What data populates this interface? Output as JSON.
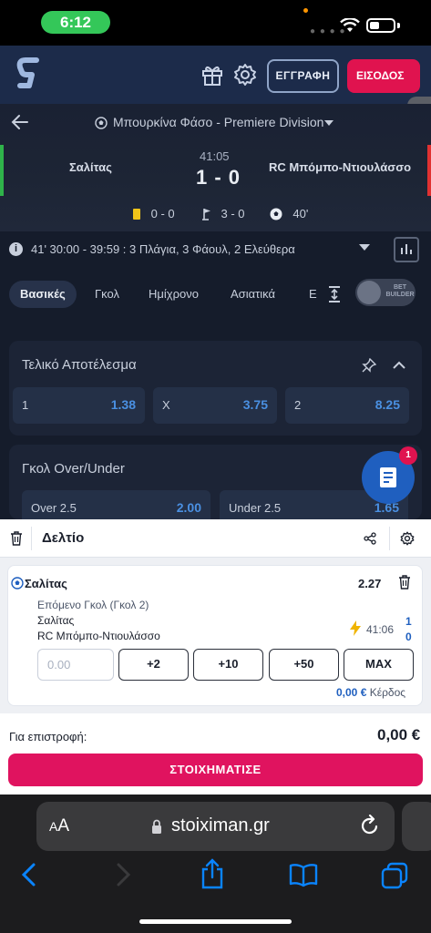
{
  "status": {
    "time": "6:12"
  },
  "header": {
    "register_label": "ΕΓΓΡΑΦΗ",
    "login_label": "ΕΙΣΟΔΟΣ"
  },
  "match": {
    "league": "Μπουρκίνα Φάσο - Premiere Division",
    "home_team": "Σαλίτας",
    "away_team": "RC Μπόμπο-Ντιουλάσσο",
    "minute": "41:05",
    "score": "1 - 0",
    "stats": {
      "cards": "0 - 0",
      "corners": "3 - 0",
      "time": "40'"
    }
  },
  "info": {
    "text": "41'  30:00 - 39:59 : 3 Πλάγια, 3 Φάουλ, 2 Ελεύθερα"
  },
  "tabs": [
    "Βασικές",
    "Γκολ",
    "Ημίχρονο",
    "Ασιατικά",
    "Ε"
  ],
  "bet_builder": "BET BUILDER",
  "markets": {
    "result": {
      "title": "Τελικό Αποτέλεσμα",
      "odds": [
        {
          "label": "1",
          "value": "1.38"
        },
        {
          "label": "X",
          "value": "3.75"
        },
        {
          "label": "2",
          "value": "8.25"
        }
      ]
    },
    "overunder": {
      "title": "Γκολ Over/Under",
      "odds": [
        {
          "label": "Over 2.5",
          "value": "2.00"
        },
        {
          "label": "Under 2.5",
          "value": "1.65"
        }
      ]
    }
  },
  "fab_badge": "1",
  "slip": {
    "title": "Δελτίο",
    "selection": {
      "team": "Σαλίτας",
      "odd": "2.27",
      "market": "Επόμενο Γκολ (Γκολ 2)",
      "team1": "Σαλίτας",
      "team2": "RC Μπόμπο-Ντιουλάσσο",
      "time": "41:06",
      "score1": "1",
      "score2": "0"
    },
    "stake_placeholder": "0.00",
    "quick": [
      "+2",
      "+10",
      "+50",
      "MAX"
    ],
    "winnings_value": "0,00 €",
    "winnings_label": "Κέρδος",
    "total_label": "Για επιστροφή:",
    "total_value": "0,00 €",
    "place_label": "ΣΤΟΙΧΗΜΑΤΙΣΕ"
  },
  "safari": {
    "url": "stoiximan.gr",
    "aa_small": "A",
    "aa_big": "A"
  }
}
